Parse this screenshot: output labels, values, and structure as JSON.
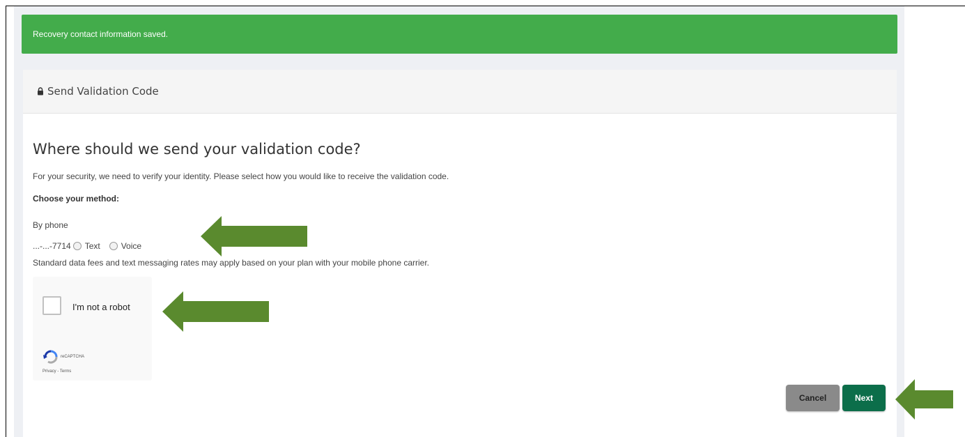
{
  "alert": {
    "message": "Recovery contact information saved.",
    "color": "#43ac4b"
  },
  "card": {
    "header_icon": "lock-icon",
    "header_title": "Send Validation Code",
    "title": "Where should we send your validation code?",
    "description": "For your security, we need to verify your identity. Please select how you would like to receive the validation code.",
    "method_label": "Choose your method:",
    "by_phone_label": "By phone",
    "phone_masked": "...-...-7714",
    "option_text": "Text",
    "option_voice": "Voice",
    "fees_note": "Standard data fees and text messaging rates may apply based on your plan with your mobile phone carrier."
  },
  "captcha": {
    "label": "I'm not a robot",
    "brand": "reCAPTCHA",
    "links": "Privacy - Terms"
  },
  "buttons": {
    "cancel": "Cancel",
    "next": "Next",
    "next_color": "#0c6e4a"
  },
  "annotations": {
    "arrow_color": "#5a8a2e",
    "arrow_icon": "left-arrow-icon"
  }
}
